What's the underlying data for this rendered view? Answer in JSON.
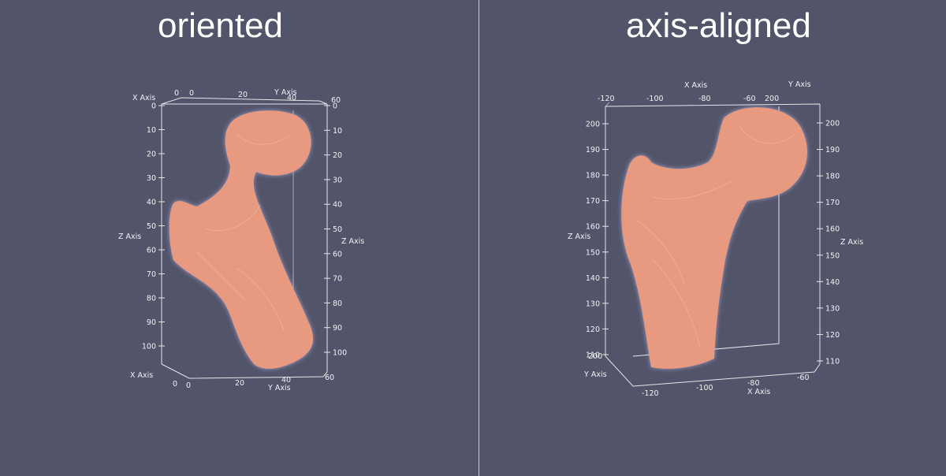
{
  "views": [
    {
      "title": "oriented",
      "axis_names": {
        "x": "X Axis",
        "y": "Y Axis",
        "z": "Z Axis"
      },
      "z_ticks_left": [
        "0",
        "10",
        "20",
        "30",
        "40",
        "50",
        "60",
        "70",
        "80",
        "90",
        "100"
      ],
      "z_ticks_right": [
        "0",
        "10",
        "20",
        "30",
        "40",
        "50",
        "60",
        "70",
        "80",
        "90",
        "100"
      ],
      "top_x_ticks": [
        "0",
        "0",
        "20",
        "40"
      ],
      "top_y_end": "60",
      "bottom_x_ticks": [
        "0",
        "0",
        "20",
        "40"
      ],
      "bottom_y_end": "60"
    },
    {
      "title": "axis-aligned",
      "axis_names": {
        "x": "X Axis",
        "y": "Y Axis",
        "z": "Z Axis"
      },
      "z_ticks_left": [
        "200",
        "190",
        "180",
        "170",
        "160",
        "150",
        "140",
        "130",
        "120",
        "110"
      ],
      "z_ticks_right": [
        "200",
        "190",
        "180",
        "170",
        "160",
        "150",
        "140",
        "130",
        "120",
        "110"
      ],
      "top_x_ticks": [
        "-120",
        "-100",
        "-80",
        "-60",
        "200"
      ],
      "bottom_x_ticks": [
        "-120",
        "-100",
        "-80",
        "-60"
      ],
      "bottom_y_tick": "200"
    }
  ],
  "colors": {
    "background": "#525469",
    "bone": "#e89a80",
    "bone_edge": "#b9b6e6",
    "axes": "#e6e6ea"
  }
}
